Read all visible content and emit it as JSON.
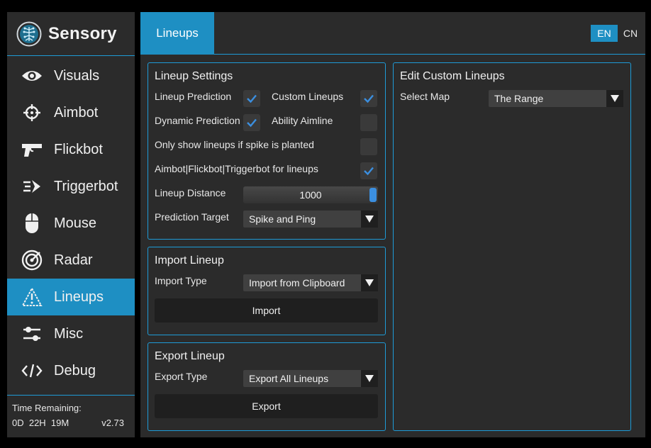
{
  "app": {
    "title": "Sensory"
  },
  "sidebar": {
    "items": [
      {
        "label": "Visuals",
        "icon": "eye-icon"
      },
      {
        "label": "Aimbot",
        "icon": "crosshair-icon"
      },
      {
        "label": "Flickbot",
        "icon": "pistol-icon"
      },
      {
        "label": "Triggerbot",
        "icon": "speed-arrow-icon"
      },
      {
        "label": "Mouse",
        "icon": "mouse-icon"
      },
      {
        "label": "Radar",
        "icon": "radar-icon"
      },
      {
        "label": "Lineups",
        "icon": "warning-triangle-icon",
        "active": true
      },
      {
        "label": "Misc",
        "icon": "sliders-icon"
      },
      {
        "label": "Debug",
        "icon": "code-icon"
      }
    ],
    "footer": {
      "time_label": "Time Remaining:",
      "time_value": "0D  22H  19M",
      "version": "v2.73"
    }
  },
  "header": {
    "active_tab": "Lineups",
    "lang": {
      "en": "EN",
      "cn": "CN",
      "selected": "EN"
    }
  },
  "lineup_settings": {
    "title": "Lineup Settings",
    "lineup_prediction": {
      "label": "Lineup Prediction",
      "checked": true
    },
    "custom_lineups": {
      "label": "Custom Lineups",
      "checked": true
    },
    "dynamic_prediction": {
      "label": "Dynamic Prediction",
      "checked": true
    },
    "ability_aimline": {
      "label": "Ability Aimline",
      "checked": false
    },
    "spike_planted": {
      "label": "Only show lineups if spike is planted",
      "checked": false
    },
    "aimbot_for_lineups": {
      "label": "Aimbot|Flickbot|Triggerbot for lineups",
      "checked": true
    },
    "lineup_distance": {
      "label": "Lineup Distance",
      "value": "1000"
    },
    "prediction_target": {
      "label": "Prediction Target",
      "value": "Spike and Ping"
    }
  },
  "import_lineup": {
    "title": "Import Lineup",
    "type_label": "Import Type",
    "type_value": "Import from Clipboard",
    "button": "Import"
  },
  "export_lineup": {
    "title": "Export Lineup",
    "type_label": "Export Type",
    "type_value": "Export All Lineups",
    "button": "Export"
  },
  "edit_custom": {
    "title": "Edit Custom Lineups",
    "map_label": "Select Map",
    "map_value": "The Range"
  },
  "colors": {
    "accent": "#1e8fc3",
    "panel": "#2b2b2b",
    "background": "#000000",
    "check": "#3b8fe0"
  }
}
